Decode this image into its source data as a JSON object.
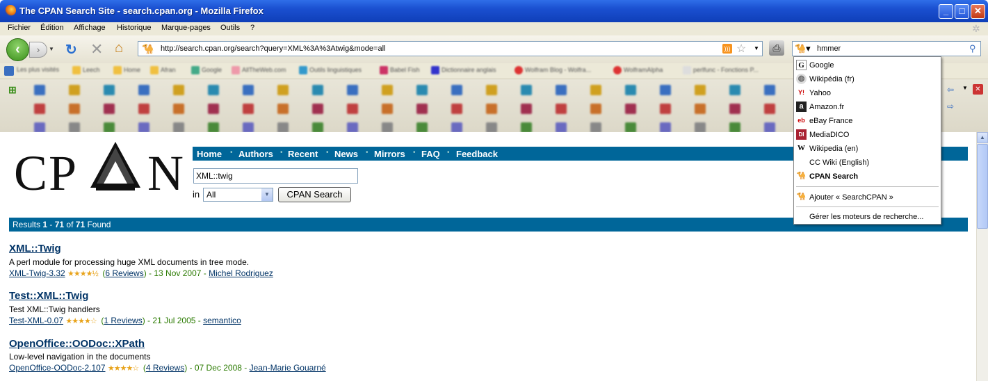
{
  "window": {
    "title": "The CPAN Search Site - search.cpan.org - Mozilla Firefox"
  },
  "menu": [
    "Fichier",
    "Édition",
    "Affichage",
    "Historique",
    "Marque-pages",
    "Outils",
    "?"
  ],
  "urlbar": {
    "url": "http://search.cpan.org/search?query=XML%3A%3Atwig&mode=all"
  },
  "searchbar": {
    "value": "hmmer"
  },
  "engine_menu": {
    "engines": [
      "Google",
      "Wikipédia (fr)",
      "Yahoo",
      "Amazon.fr",
      "eBay France",
      "MediaDICO",
      "Wikipedia (en)",
      "CC Wiki (English)",
      "CPAN Search"
    ],
    "selected": "CPAN Search",
    "add": "Ajouter « SearchCPAN »",
    "manage": "Gérer les moteurs de recherche..."
  },
  "bookmarks": [
    "Les plus visités",
    "Leech",
    "Home",
    "Afran",
    "Google",
    "AllTheWeb.com",
    "Outils linguistiques",
    "Babel Fish",
    "Dictionnaire anglais",
    "Wolfram Blog - Wolfra...",
    "WolframAlpha",
    "perlfunc - Fonctions P..."
  ],
  "cpan": {
    "logo": "CPAN",
    "nav": [
      "Home",
      "Authors",
      "Recent",
      "News",
      "Mirrors",
      "FAQ",
      "Feedback"
    ],
    "query": "XML::twig",
    "in_label": "in",
    "scope": "All",
    "button": "CPAN Search",
    "results_bar": {
      "prefix": "Results ",
      "from": "1",
      "dash": " - ",
      "to": "71",
      "of": " of ",
      "total": "71",
      "suffix": " Found"
    },
    "results": [
      {
        "title": "XML::Twig",
        "desc": "A perl module for processing huge XML documents in tree mode.",
        "dist": "XML-Twig-3.32",
        "stars": "★★★★½",
        "rating": 4.5,
        "reviews": "6 Reviews",
        "date": "13 Nov 2007",
        "author": "Michel Rodriguez"
      },
      {
        "title": "Test::XML::Twig",
        "desc": "Test XML::Twig handlers",
        "dist": "Test-XML-0.07",
        "stars": "★★★★☆",
        "rating": 4,
        "reviews": "1 Reviews",
        "date": "21 Jul 2005",
        "author": "semantico"
      },
      {
        "title": "OpenOffice::OODoc::XPath",
        "desc": "Low-level navigation in the documents",
        "dist": "OpenOffice-OODoc-2.107",
        "stars": "★★★★☆",
        "rating": 4,
        "reviews": "4 Reviews",
        "date": "07 Dec 2008",
        "author": "Jean-Marie Gouarné"
      }
    ]
  },
  "colors": {
    "cpan_blue": "#006699",
    "link": "#003366",
    "date_green": "#2a7a00",
    "titlebar": "#1a4fd0"
  }
}
